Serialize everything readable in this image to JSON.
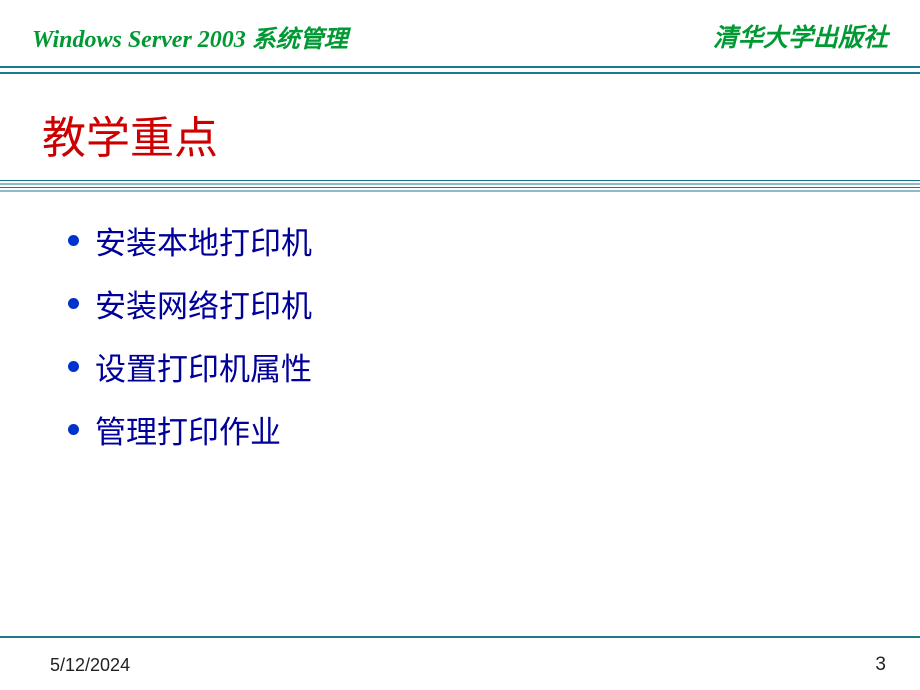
{
  "header": {
    "left": "Windows Server 2003 系统管理",
    "right": "清华大学出版社"
  },
  "title": "教学重点",
  "bullets": [
    "安装本地打印机",
    "安装网络打印机",
    "设置打印机属性",
    "管理打印作业"
  ],
  "footer": {
    "date": "5/12/2024",
    "page": "3"
  }
}
